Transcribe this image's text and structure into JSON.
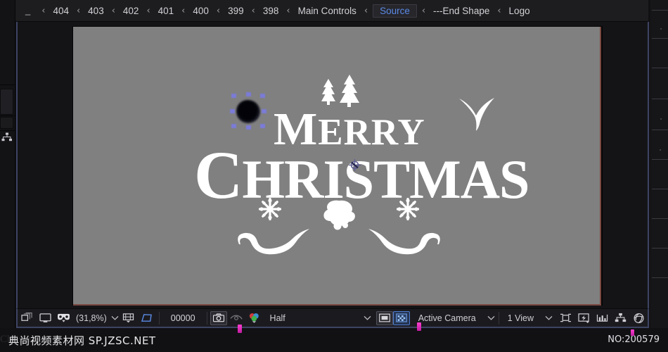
{
  "breadcrumb": {
    "leading": "_",
    "separator": "‹",
    "items": [
      {
        "label": "404",
        "active": false
      },
      {
        "label": "403",
        "active": false
      },
      {
        "label": "402",
        "active": false
      },
      {
        "label": "401",
        "active": false
      },
      {
        "label": "400",
        "active": false
      },
      {
        "label": "399",
        "active": false
      },
      {
        "label": "398",
        "active": false
      },
      {
        "label": "Main Controls",
        "active": false
      },
      {
        "label": "Source",
        "active": true
      },
      {
        "label": "---End Shape",
        "active": false
      },
      {
        "label": "Logo",
        "active": false
      }
    ],
    "active_color": "#5b8ae6"
  },
  "left_rail": {
    "icons": [
      {
        "name": "flowchart-icon",
        "label": "flowchart-icon"
      }
    ]
  },
  "viewer": {
    "background_color": "#808080",
    "canvas_border_color": "#7a4a42",
    "panel_border_color": "#3d4463",
    "artwork": {
      "line1": "Merry",
      "line1_initial": "M",
      "line1_rest": "ERRY",
      "line2": "Christmas",
      "line2_initial": "C",
      "line2_rest": "HRISTMAS",
      "decorations": [
        "christmas-trees",
        "snowflakes",
        "holly",
        "flourishes"
      ]
    },
    "selection": {
      "handle_color": "#7b7bd8",
      "handle_count": 8,
      "anchor_point": "anchor-point-marker"
    }
  },
  "toolbar": {
    "zoom_level": "(31,8%)",
    "timecode": "00000",
    "resolution": "Half",
    "camera_view": "Active Camera",
    "view_layout": "1 View",
    "chevron": "⌄",
    "icons_left": [
      {
        "name": "toggle-viewer-lock-icon"
      },
      {
        "name": "monitor-icon"
      },
      {
        "name": "3d-glasses-icon"
      }
    ],
    "icons_mid": [
      {
        "name": "title-action-safe-icon",
        "selected": false
      },
      {
        "name": "mask-shape-icon",
        "selected": true
      }
    ],
    "icons_snapshot": [
      {
        "name": "take-snapshot-camera-icon",
        "selected": true
      },
      {
        "name": "show-snapshot-icon",
        "selected": false
      },
      {
        "name": "show-channel-rgb-icon",
        "selected": false
      }
    ],
    "icons_region": [
      {
        "name": "region-of-interest-icon",
        "selected": false
      },
      {
        "name": "transparency-grid-icon",
        "selected": true
      }
    ],
    "icons_right": [
      {
        "name": "pixel-aspect-correction-icon"
      },
      {
        "name": "fast-previews-icon"
      },
      {
        "name": "timeline-graph-icon"
      },
      {
        "name": "flowchart-icon"
      },
      {
        "name": "reset-exposure-icon"
      }
    ]
  },
  "watermark": {
    "left_text": "典尚视频素材网 SP.JZSC.NET",
    "ghost_text": "Christmas",
    "right_text": "NO:200579"
  }
}
